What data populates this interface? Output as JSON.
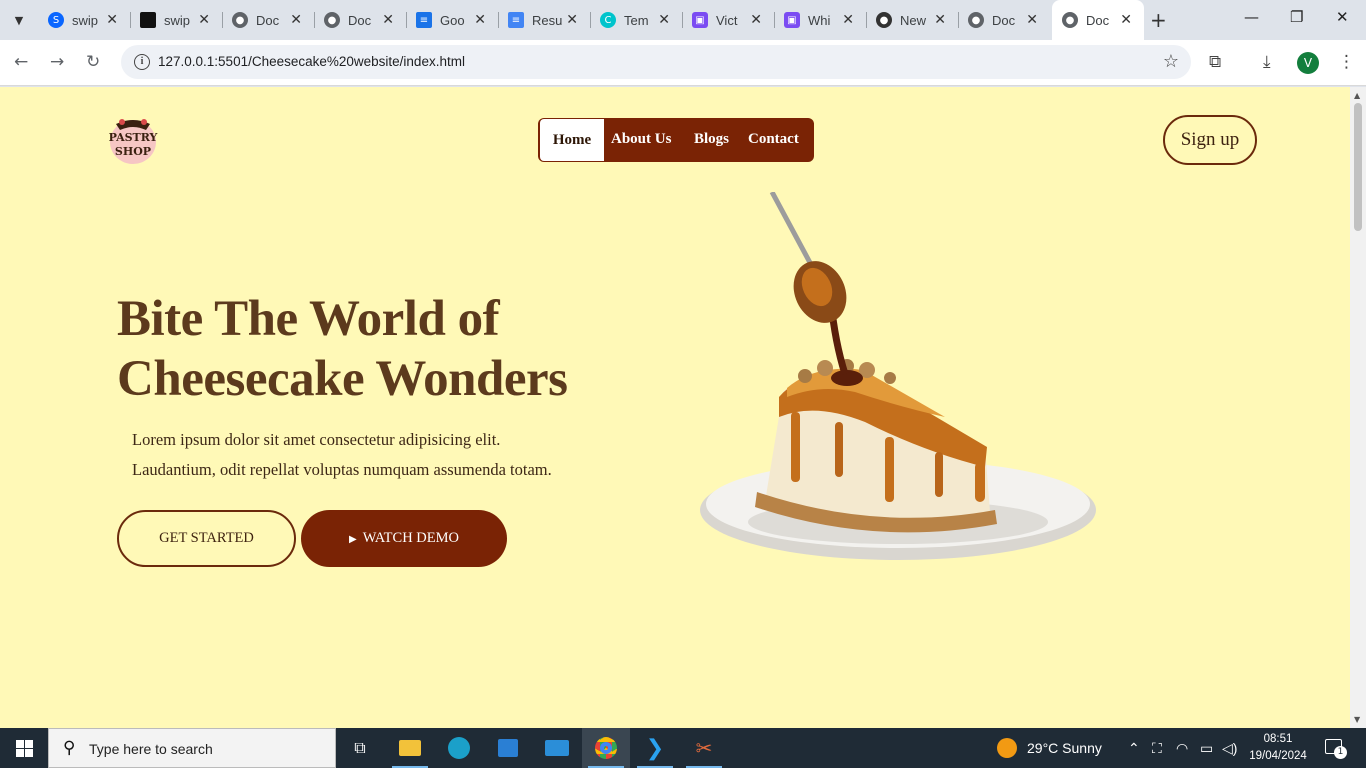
{
  "browser": {
    "tabs": [
      {
        "label": "swip",
        "icon": "swiper-icon",
        "color": "#0a66ff"
      },
      {
        "label": "swip",
        "icon": "swiper-dark-icon",
        "color": "#111111"
      },
      {
        "label": "Doc",
        "icon": "globe-icon",
        "color": "#5f6368"
      },
      {
        "label": "Doc",
        "icon": "globe-icon",
        "color": "#5f6368"
      },
      {
        "label": "Goo",
        "icon": "google-docs-icon",
        "color": "#1a73e8"
      },
      {
        "label": "Resu",
        "icon": "docs-icon",
        "color": "#4285f4"
      },
      {
        "label": "Tem",
        "icon": "canva-icon",
        "color": "#00c4cc"
      },
      {
        "label": "Vict",
        "icon": "print-icon",
        "color": "#7b4cf2"
      },
      {
        "label": "Whi",
        "icon": "print-icon",
        "color": "#7b4cf2"
      },
      {
        "label": "New",
        "icon": "github-icon",
        "color": "#333333"
      },
      {
        "label": "Doc",
        "icon": "globe-icon",
        "color": "#5f6368"
      },
      {
        "label": "Doc",
        "icon": "globe-icon",
        "color": "#5f6368"
      }
    ],
    "active_tab_index": 11,
    "url": "127.0.0.1:5501/Cheesecake%20website/index.html",
    "profile_initial": "V"
  },
  "site": {
    "logo_text": [
      "PASTRY",
      "SHOP"
    ],
    "nav": [
      "Home",
      "About Us",
      "Blogs",
      "Contact"
    ],
    "active_nav": "Home",
    "signup_label": "Sign up",
    "hero": {
      "title_line1": "Bite The World of",
      "title_line2": "Cheesecake Wonders",
      "text_line1": "Lorem ipsum dolor sit amet consectetur adipisicing elit.",
      "text_line2": "Laudantium, odit repellat voluptas numquam assumenda totam.",
      "cta_primary": "GET STARTED",
      "cta_secondary": "WATCH DEMO"
    },
    "colors": {
      "background": "#fff9b7",
      "brand": "#7a2305",
      "title": "#5c3a1d"
    }
  },
  "taskbar": {
    "search_placeholder": "Type here to search",
    "weather": "29°C  Sunny",
    "time": "08:51",
    "date": "19/04/2024",
    "notification_count": "1"
  }
}
